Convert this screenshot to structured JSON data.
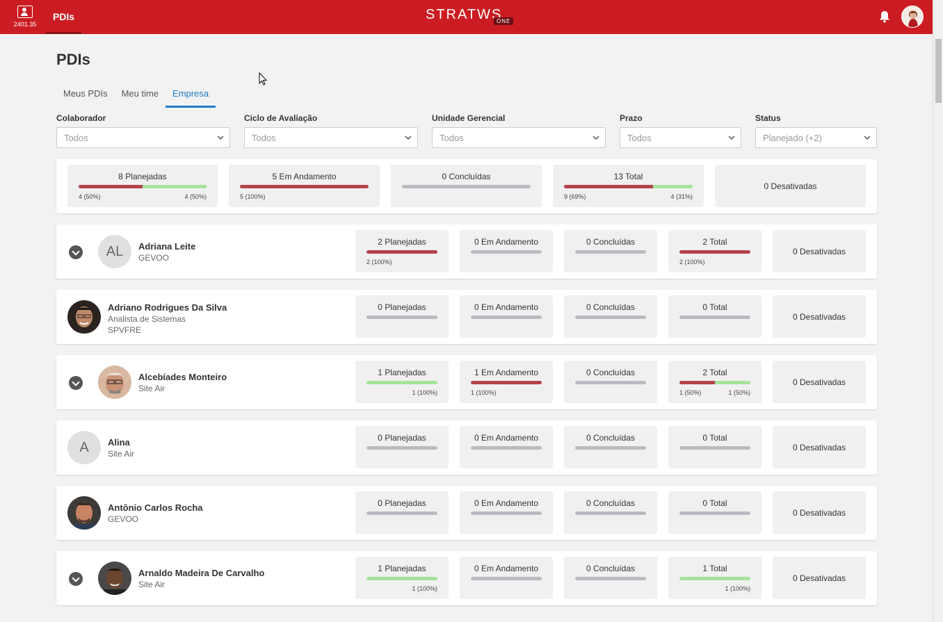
{
  "app": {
    "version": "2401.35",
    "nav_tab": "PDIs",
    "logo_text": "STRATWS",
    "logo_badge": "ONE",
    "brand_color": "#cc1c23"
  },
  "page": {
    "title": "PDIs",
    "tabs": [
      {
        "label": "Meus PDIs",
        "active": false
      },
      {
        "label": "Meu time",
        "active": false
      },
      {
        "label": "Empresa",
        "active": true
      }
    ]
  },
  "filters": [
    {
      "label": "Colaborador",
      "value": "Todos"
    },
    {
      "label": "Ciclo de Avaliação",
      "value": "Todos"
    },
    {
      "label": "Unidade Gerencial",
      "value": "Todos"
    },
    {
      "label": "Prazo",
      "value": "Todos"
    },
    {
      "label": "Status",
      "value": "Planejado (+2)"
    }
  ],
  "summary": {
    "planejadas": {
      "title": "8 Planejadas",
      "left": "4 (50%)",
      "right": "4 (50%)",
      "red": 50,
      "green": 50
    },
    "andamento": {
      "title": "5 Em Andamento",
      "left": "5 (100%)",
      "red": 100
    },
    "concluidas": {
      "title": "0 Concluídas"
    },
    "total": {
      "title": "13 Total",
      "left": "9 (69%)",
      "right": "4 (31%)",
      "red": 69,
      "green": 31
    },
    "desativadas": {
      "title": "0 Desativadas"
    }
  },
  "rows": [
    {
      "name": "Adriana Leite",
      "sub": "GEVOO",
      "sub2": "",
      "initials": "AL",
      "expandable": true,
      "planejadas": {
        "title": "2 Planejadas",
        "left": "2 (100%)",
        "right": "",
        "red": 100,
        "green": 0
      },
      "andamento": {
        "title": "0 Em Andamento",
        "left": "",
        "red": 0
      },
      "concluidas": {
        "title": "0 Concluídas"
      },
      "total": {
        "title": "2 Total",
        "left": "2 (100%)",
        "right": "",
        "red": 100,
        "green": 0
      },
      "desativadas": {
        "title": "0 Desativadas"
      }
    },
    {
      "name": "Adriano Rodrigues Da Silva",
      "sub": "Analista de Sistemas",
      "sub2": "SPVFRE",
      "initials": "",
      "expandable": false,
      "planejadas": {
        "title": "0 Planejadas",
        "left": "",
        "right": "",
        "red": 0,
        "green": 0
      },
      "andamento": {
        "title": "0 Em Andamento",
        "left": "",
        "red": 0
      },
      "concluidas": {
        "title": "0 Concluídas"
      },
      "total": {
        "title": "0 Total",
        "left": "",
        "right": "",
        "red": 0,
        "green": 0
      },
      "desativadas": {
        "title": "0 Desativadas"
      }
    },
    {
      "name": "Alcebíades Monteiro",
      "sub": "Site Air",
      "sub2": "",
      "initials": "",
      "expandable": true,
      "planejadas": {
        "title": "1 Planejadas",
        "left": "",
        "right": "1 (100%)",
        "red": 0,
        "green": 100
      },
      "andamento": {
        "title": "1 Em Andamento",
        "left": "1 (100%)",
        "red": 100
      },
      "concluidas": {
        "title": "0 Concluídas"
      },
      "total": {
        "title": "2 Total",
        "left": "1 (50%)",
        "right": "1 (50%)",
        "red": 50,
        "green": 50
      },
      "desativadas": {
        "title": "0 Desativadas"
      }
    },
    {
      "name": "Alina",
      "sub": "Site Air",
      "sub2": "",
      "initials": "A",
      "expandable": false,
      "planejadas": {
        "title": "0 Planejadas",
        "left": "",
        "right": "",
        "red": 0,
        "green": 0
      },
      "andamento": {
        "title": "0 Em Andamento",
        "left": "",
        "red": 0
      },
      "concluidas": {
        "title": "0 Concluídas"
      },
      "total": {
        "title": "0 Total",
        "left": "",
        "right": "",
        "red": 0,
        "green": 0
      },
      "desativadas": {
        "title": "0 Desativadas"
      }
    },
    {
      "name": "Antônio Carlos Rocha",
      "sub": "GEVOO",
      "sub2": "",
      "initials": "",
      "expandable": false,
      "planejadas": {
        "title": "0 Planejadas",
        "left": "",
        "right": "",
        "red": 0,
        "green": 0
      },
      "andamento": {
        "title": "0 Em Andamento",
        "left": "",
        "red": 0
      },
      "concluidas": {
        "title": "0 Concluídas"
      },
      "total": {
        "title": "0 Total",
        "left": "",
        "right": "",
        "red": 0,
        "green": 0
      },
      "desativadas": {
        "title": "0 Desativadas"
      }
    },
    {
      "name": "Arnaldo Madeira De Carvalho",
      "sub": "Site Air",
      "sub2": "",
      "initials": "",
      "expandable": true,
      "planejadas": {
        "title": "1 Planejadas",
        "left": "",
        "right": "1 (100%)",
        "red": 0,
        "green": 100
      },
      "andamento": {
        "title": "0 Em Andamento",
        "left": "",
        "red": 0
      },
      "concluidas": {
        "title": "0 Concluídas"
      },
      "total": {
        "title": "1 Total",
        "left": "",
        "right": "1 (100%)",
        "red": 0,
        "green": 100
      },
      "desativadas": {
        "title": "0 Desativadas"
      }
    }
  ]
}
